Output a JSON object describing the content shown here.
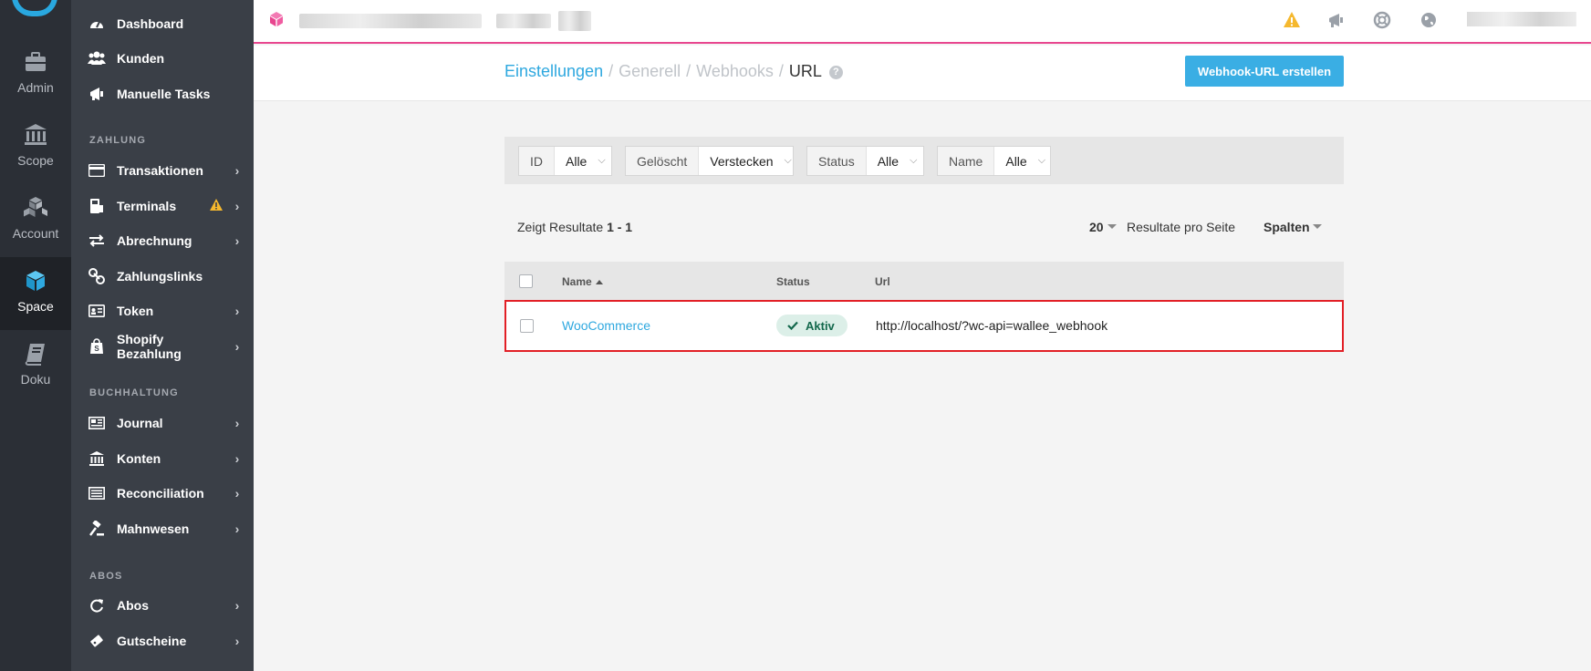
{
  "rail": {
    "items": [
      {
        "label": "Admin",
        "icon": "briefcase-icon"
      },
      {
        "label": "Scope",
        "icon": "bank-icon"
      },
      {
        "label": "Account",
        "icon": "boxes-icon"
      },
      {
        "label": "Space",
        "icon": "cube-icon",
        "active": true
      },
      {
        "label": "Doku",
        "icon": "book-icon"
      }
    ]
  },
  "sidebar": {
    "items_top": [
      {
        "label": "Dashboard",
        "icon": "gauge-icon"
      },
      {
        "label": "Kunden",
        "icon": "users-icon"
      },
      {
        "label": "Manuelle Tasks",
        "icon": "megaphone-icon"
      }
    ],
    "section_zahlung": "ZAHLUNG",
    "items_zahlung": [
      {
        "label": "Transaktionen",
        "icon": "credit-card-icon",
        "chevron": true
      },
      {
        "label": "Terminals",
        "icon": "terminal-icon",
        "chevron": true,
        "warning": true
      },
      {
        "label": "Abrechnung",
        "icon": "exchange-icon",
        "chevron": true
      },
      {
        "label": "Zahlungslinks",
        "icon": "link-icon",
        "chevron": false
      },
      {
        "label": "Token",
        "icon": "id-card-icon",
        "chevron": true
      },
      {
        "label": "Shopify Bezahlung",
        "icon": "shopping-bag-icon",
        "chevron": true
      }
    ],
    "section_buchhaltung": "BUCHHALTUNG",
    "items_buchhaltung": [
      {
        "label": "Journal",
        "icon": "newspaper-icon",
        "chevron": true
      },
      {
        "label": "Konten",
        "icon": "bank-icon",
        "chevron": true
      },
      {
        "label": "Reconciliation",
        "icon": "list-icon",
        "chevron": true
      },
      {
        "label": "Mahnwesen",
        "icon": "gavel-icon",
        "chevron": true
      }
    ],
    "section_abos": "ABOS",
    "items_abos": [
      {
        "label": "Abos",
        "icon": "refresh-icon",
        "chevron": true
      },
      {
        "label": "Gutscheine",
        "icon": "ticket-icon",
        "chevron": true
      }
    ]
  },
  "breadcrumb": {
    "einstellungen": "Einstellungen",
    "generell": "Generell",
    "webhooks": "Webhooks",
    "current": "URL",
    "separator": "/",
    "help": "?"
  },
  "actions": {
    "create_label": "Webhook-URL erstellen"
  },
  "filters": [
    {
      "name": "ID",
      "value": "Alle"
    },
    {
      "name": "Gelöscht",
      "value": "Verstecken"
    },
    {
      "name": "Status",
      "value": "Alle"
    },
    {
      "name": "Name",
      "value": "Alle"
    }
  ],
  "results": {
    "prefix": "Zeigt Resultate",
    "range": "1 - 1",
    "per_page": "20",
    "per_page_label": "Resultate pro Seite",
    "columns_label": "Spalten"
  },
  "table": {
    "headers": {
      "name": "Name",
      "status": "Status",
      "url": "Url"
    },
    "rows": [
      {
        "name": "WooCommerce",
        "status": "Aktiv",
        "url": "http://localhost/?wc-api=wallee_webhook"
      }
    ]
  },
  "colors": {
    "accent": "#2ea8df",
    "topbar_border": "#e8468f",
    "highlight": "#e21f26",
    "status_active_bg": "#dcefe8",
    "status_active_text": "#13684c"
  }
}
